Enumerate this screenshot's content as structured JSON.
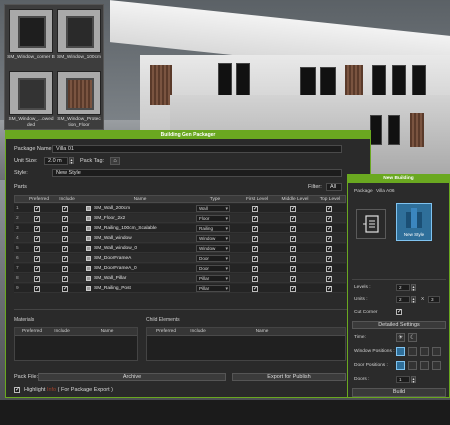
{
  "library": {
    "items": [
      {
        "label": "SM_Window_corner B"
      },
      {
        "label": "SM_Window_100cm"
      },
      {
        "label": "SM_Window_...owed ded"
      },
      {
        "label": "SM_Window_Protec tion_Floor"
      }
    ]
  },
  "packager": {
    "title": "Building Gen Packager",
    "package_name_label": "Package Name:",
    "package_name_value": "Villa 01",
    "unit_size_label": "Unit Size:",
    "unit_size_value": "2.0 m",
    "pack_tag_label": "Pack Tag:",
    "style_label": "Style:",
    "style_value": "New Style",
    "parts_label": "Parts",
    "filter_label": "Filter:",
    "filter_value": "All",
    "columns": [
      "Preferred",
      "Include",
      "Name",
      "Type",
      "First Level",
      "Middle Level",
      "Top Level"
    ],
    "rows": [
      {
        "idx": "1",
        "name": "SM_Wall_200cm",
        "type": "Wall"
      },
      {
        "idx": "2",
        "name": "SM_Floor_2x2",
        "type": "Floor"
      },
      {
        "idx": "3",
        "name": "SM_Railing_100cm_Scalable",
        "type": "Railing"
      },
      {
        "idx": "4",
        "name": "SM_Wall_window",
        "type": "Window"
      },
      {
        "idx": "5",
        "name": "SM_Wall_window_0",
        "type": "Window"
      },
      {
        "idx": "6",
        "name": "SM_DoorFrameA",
        "type": "Door"
      },
      {
        "idx": "7",
        "name": "SM_DoorFrameA_0",
        "type": "Door"
      },
      {
        "idx": "8",
        "name": "SM_Wall_Pillar",
        "type": "Pillar"
      },
      {
        "idx": "9",
        "name": "SM_Railing_Post",
        "type": "Pillar"
      }
    ],
    "materials_label": "Materials",
    "child_elements_label": "Child Elements",
    "mat_columns": [
      "Preferred",
      "Include",
      "Name"
    ],
    "child_columns": [
      "Preferred",
      "Include",
      "Name"
    ],
    "pack_file_label": "Pack File:",
    "archive_label": "Archive",
    "export_publish_label": "Export for Publish",
    "highlight_prefix": "Highlight",
    "highlight_word": "Info",
    "highlight_suffix": "( For Package Export )"
  },
  "new_building": {
    "title": "New Building",
    "package_label": "Package",
    "package_value": "Villa A06",
    "style_name": "New Style",
    "levels_label": "Levels :",
    "levels_value": "2",
    "units_label": "Units :",
    "units_x_value": "2",
    "units_x_sep": "X",
    "units_y_value": "3",
    "cut_corner_label": "Cut Corner",
    "detailed_settings_label": "Detailed Settings",
    "time_label": "Time:",
    "window_positions_label": "Window Positions :",
    "door_positions_label": "Door Positions :",
    "doors_label": "Doors :",
    "doors_value": "1",
    "build_label": "Build"
  },
  "colors": {
    "accent": "#6aa820",
    "selected_style": "#2f6f9a"
  }
}
